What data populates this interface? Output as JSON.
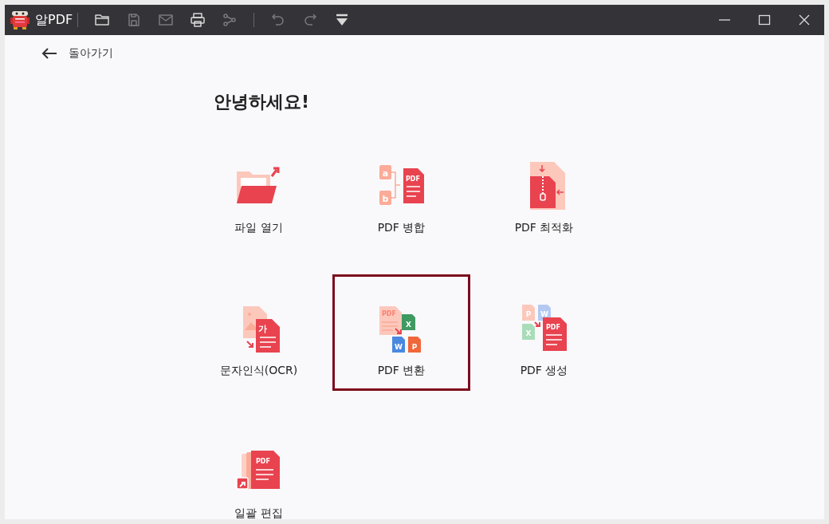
{
  "window": {
    "title": "알PDF"
  },
  "toolbar": [
    {
      "kind": "folder",
      "disabled": false
    },
    {
      "kind": "save",
      "disabled": true
    },
    {
      "kind": "mail",
      "disabled": true
    },
    {
      "kind": "print",
      "disabled": false
    },
    {
      "kind": "share",
      "disabled": true
    },
    {
      "kind": "separator"
    },
    {
      "kind": "undo",
      "disabled": true
    },
    {
      "kind": "redo",
      "disabled": true
    },
    {
      "kind": "dropdown",
      "disabled": false
    }
  ],
  "back": {
    "label": "돌아가기"
  },
  "greeting": "안녕하세요!",
  "tiles": [
    {
      "kind": "open",
      "label": "파일 열기",
      "selected": false
    },
    {
      "kind": "merge",
      "label": "PDF 병합",
      "selected": false,
      "icon_marks": [
        "a",
        "b",
        "PDF"
      ]
    },
    {
      "kind": "compress",
      "label": "PDF 최적화",
      "selected": false
    },
    {
      "kind": "ocr",
      "label": "문자인식(OCR)",
      "selected": false,
      "icon_marks": [
        "가"
      ]
    },
    {
      "kind": "convert",
      "label": "PDF 변환",
      "selected": true,
      "icon_marks": [
        "PDF",
        "X",
        "W",
        "P"
      ]
    },
    {
      "kind": "create",
      "label": "PDF 생성",
      "selected": false,
      "icon_marks": [
        "P",
        "W",
        "X",
        "PDF"
      ]
    },
    {
      "kind": "batch",
      "label": "일괄 편집",
      "selected": false,
      "icon_marks": [
        "PDF"
      ]
    }
  ]
}
